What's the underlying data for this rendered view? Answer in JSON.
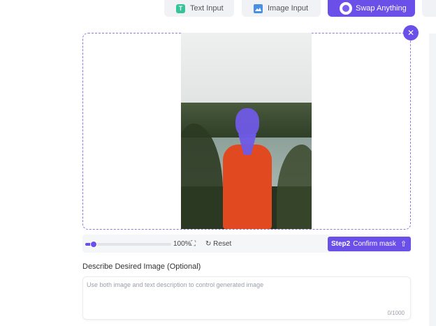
{
  "tabs": [
    {
      "label": "Text Input",
      "icon": "text-input-icon",
      "active": false
    },
    {
      "label": "Image Input",
      "icon": "image-input-icon",
      "active": false
    },
    {
      "label": "Swap Anything",
      "icon": "swap-anything-icon",
      "active": true
    }
  ],
  "canvas": {
    "close_icon": "close-icon",
    "mask_color": "#6f5ae6"
  },
  "toolbar": {
    "zoom": "100%",
    "reset_label": "Reset",
    "zoom_slider_fraction": 0.1
  },
  "confirm": {
    "step": "Step2",
    "label": "Confirm mask"
  },
  "describe": {
    "label": "Describe Desired Image (Optional)",
    "placeholder": "Use both image and text description to control generated image",
    "value": "",
    "counter": "0/1000"
  },
  "colors": {
    "accent": "#6a4fe8"
  }
}
